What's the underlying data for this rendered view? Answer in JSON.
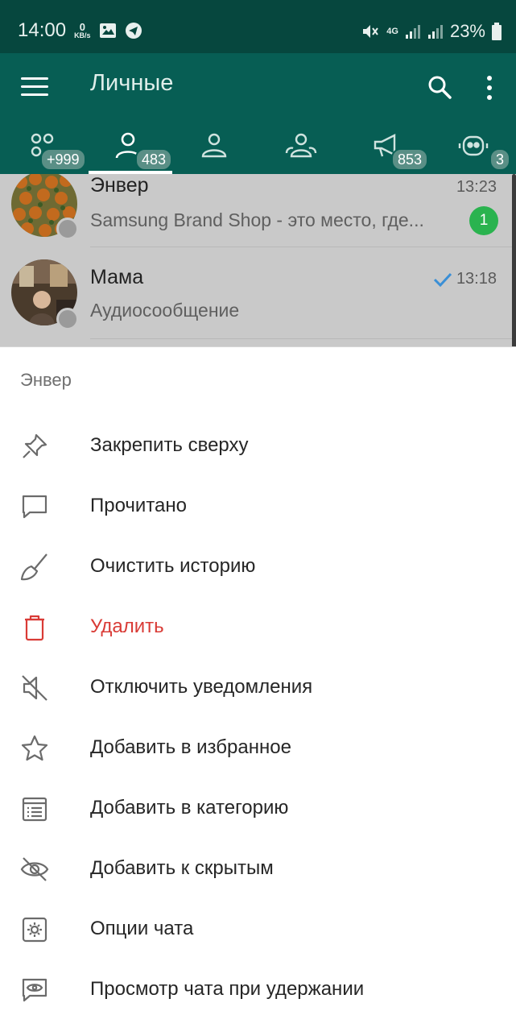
{
  "status_bar": {
    "time": "14:00",
    "kbs_value": "0",
    "kbs_unit": "KB/s",
    "network": "4G",
    "battery": "23%"
  },
  "app_bar": {
    "title": "Личные",
    "icons": [
      "menu-icon",
      "search-icon",
      "more-vert-icon"
    ]
  },
  "tabs": [
    {
      "icon": "all-chats-icon",
      "badge": "+999"
    },
    {
      "icon": "person-icon",
      "badge": "483",
      "active": true
    },
    {
      "icon": "group-icon",
      "badge": ""
    },
    {
      "icon": "supergroup-icon",
      "badge": ""
    },
    {
      "icon": "channel-icon",
      "badge": "853"
    },
    {
      "icon": "bot-icon",
      "badge": "3"
    }
  ],
  "chats": [
    {
      "name": "Энвер",
      "preview": "Samsung Brand Shop - это место, где...",
      "time": "13:23",
      "unread": "1"
    },
    {
      "name": "Мама",
      "preview": "Аудиосообщение",
      "time": "13:18",
      "read_check": true
    }
  ],
  "sheet": {
    "title": "Энвер",
    "items": [
      {
        "label": "Закрепить сверху",
        "icon": "pin-icon"
      },
      {
        "label": "Прочитано",
        "icon": "message-icon"
      },
      {
        "label": "Очистить историю",
        "icon": "broom-icon"
      },
      {
        "label": "Удалить",
        "icon": "trash-icon",
        "danger": true
      },
      {
        "label": "Отключить уведомления",
        "icon": "mute-icon"
      },
      {
        "label": "Добавить в избранное",
        "icon": "star-icon"
      },
      {
        "label": "Добавить в категорию",
        "icon": "category-list-icon"
      },
      {
        "label": "Добавить к скрытым",
        "icon": "eye-off-icon"
      },
      {
        "label": "Опции чата",
        "icon": "gear-icon"
      },
      {
        "label": "Просмотр чата при удержании",
        "icon": "preview-eye-icon"
      }
    ]
  },
  "colors": {
    "status_bar": "#06473e",
    "app_bar": "#075e54",
    "unread_badge": "#2ab34f",
    "danger": "#d93b36",
    "read_check": "#3a8fd6"
  }
}
